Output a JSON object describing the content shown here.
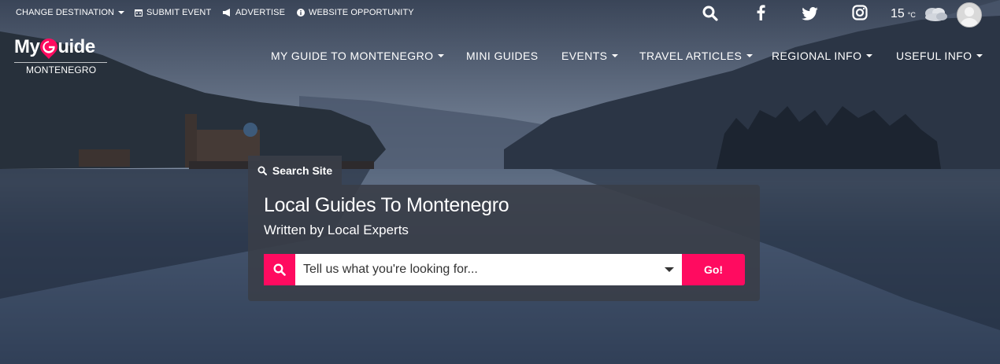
{
  "topbar": {
    "change_destination": "CHANGE DESTINATION",
    "submit_event": "SUBMIT EVENT",
    "advertise": "ADVERTISE",
    "website_opportunity": "WEBSITE OPPORTUNITY",
    "temperature": "15",
    "temperature_unit": "°C",
    "icons": [
      "search-icon",
      "facebook-icon",
      "twitter-icon",
      "instagram-icon",
      "cloudy-weather-icon",
      "avatar"
    ]
  },
  "logo": {
    "my": "My",
    "guide": "uide",
    "subtitle": "MONTENEGRO"
  },
  "nav": {
    "items": [
      {
        "label": "MY GUIDE TO MONTENEGRO",
        "dropdown": true
      },
      {
        "label": "MINI GUIDES",
        "dropdown": false
      },
      {
        "label": "EVENTS",
        "dropdown": true
      },
      {
        "label": "TRAVEL ARTICLES",
        "dropdown": true
      },
      {
        "label": "REGIONAL INFO",
        "dropdown": true
      },
      {
        "label": "USEFUL INFO",
        "dropdown": true
      }
    ]
  },
  "search": {
    "tab_label": "Search Site",
    "heading": "Local Guides To Montenegro",
    "subheading": "Written by Local Experts",
    "placeholder": "Tell us what you're looking for...",
    "go_label": "Go!"
  },
  "colors": {
    "accent": "#ff0b60",
    "panel": "#3a3e48"
  }
}
